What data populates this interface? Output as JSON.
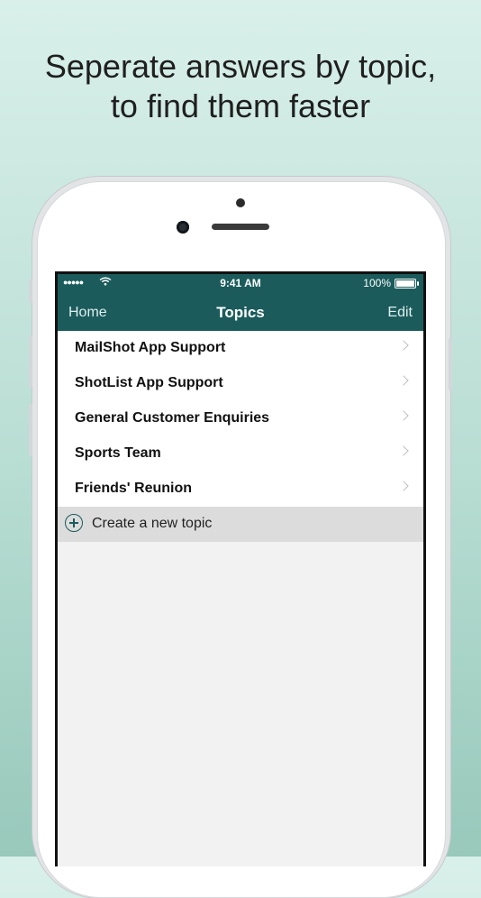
{
  "headline": {
    "line1": "Seperate answers by topic,",
    "line2": "to find them faster"
  },
  "status_bar": {
    "signal": "●●●●●",
    "wifi_icon": "wifi-icon",
    "time": "9:41 AM",
    "battery": "100%"
  },
  "nav": {
    "left": "Home",
    "title": "Topics",
    "right": "Edit"
  },
  "topics": [
    {
      "label": "MailShot App Support"
    },
    {
      "label": "ShotList App Support"
    },
    {
      "label": "General Customer Enquiries"
    },
    {
      "label": "Sports Team"
    },
    {
      "label": "Friends' Reunion"
    }
  ],
  "create": {
    "label": "Create a new topic"
  },
  "colors": {
    "accent": "#1b5b5b",
    "background_top": "#d9f0ea",
    "background_bottom": "#98c9bb"
  }
}
